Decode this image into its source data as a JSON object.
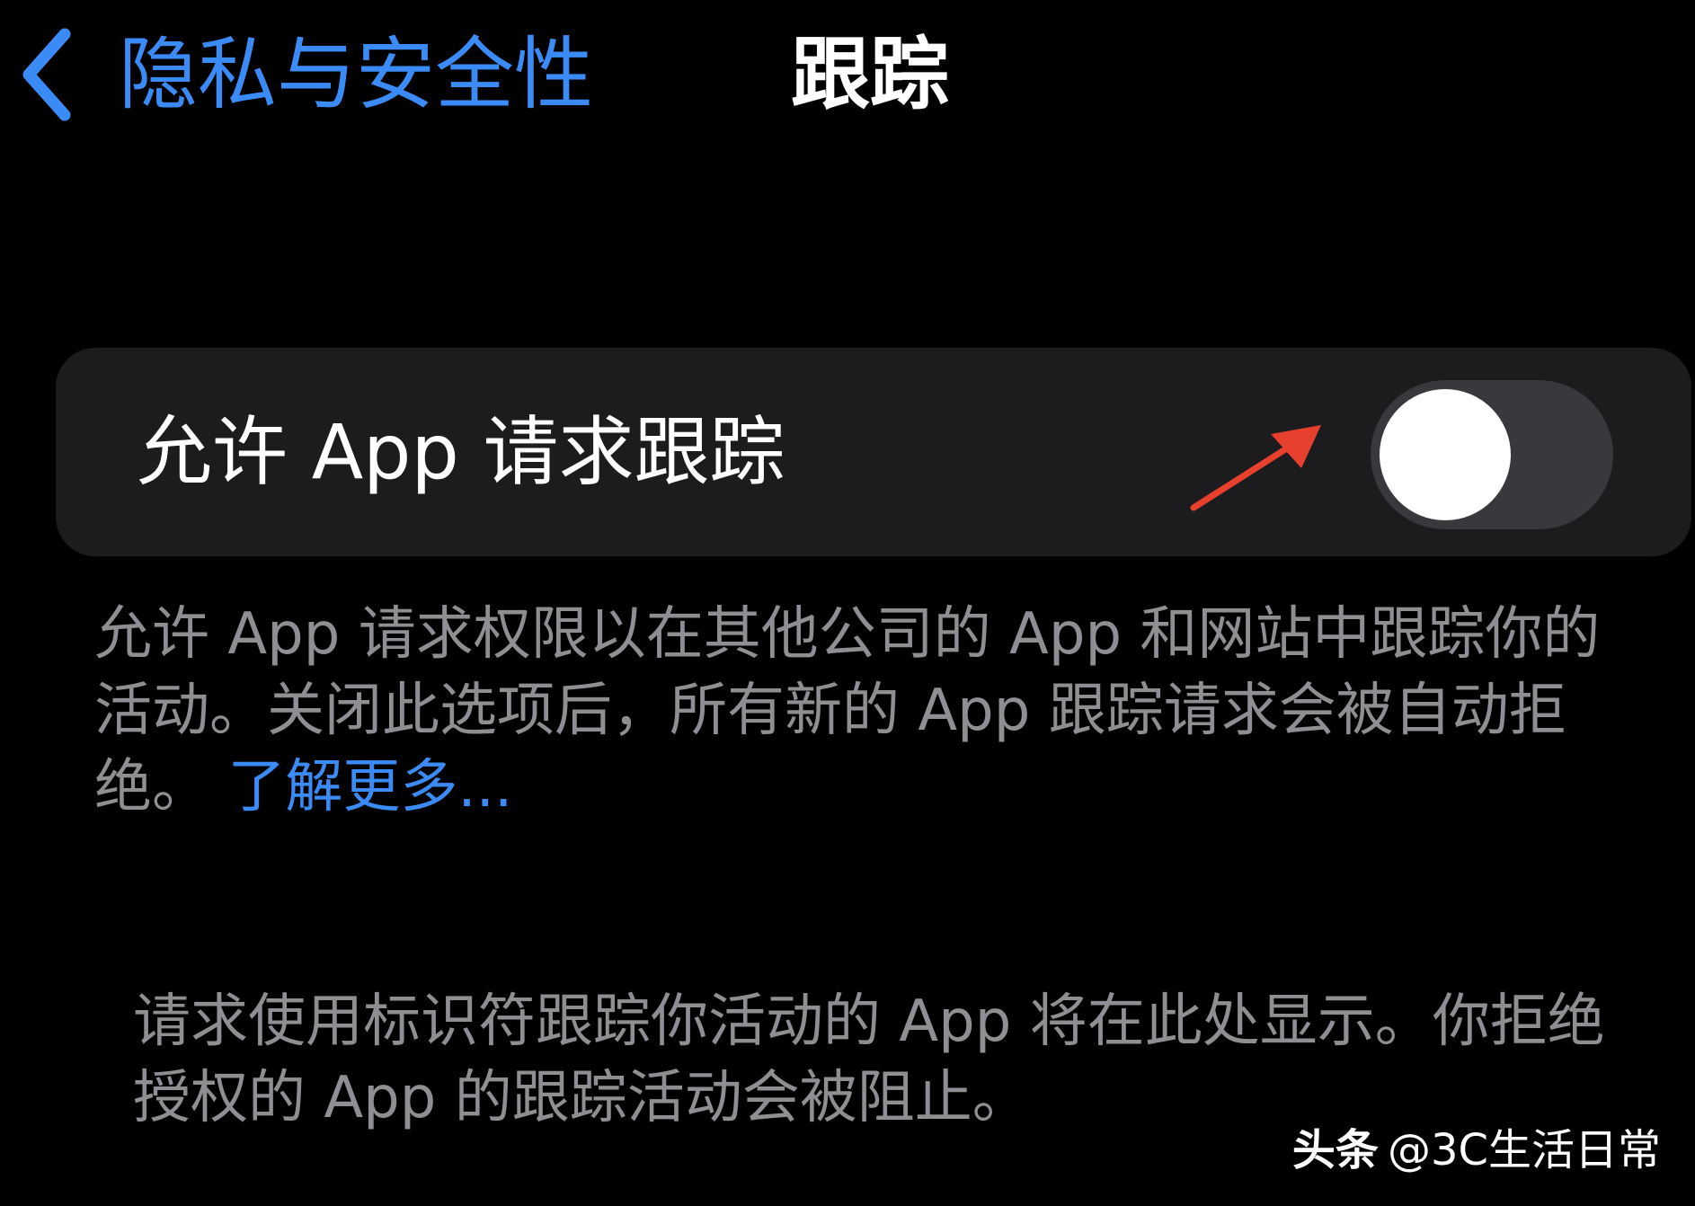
{
  "nav": {
    "back_label": "隐私与安全性",
    "title": "跟踪"
  },
  "toggle": {
    "label": "允许 App 请求跟踪",
    "state": "off"
  },
  "description": {
    "text": "允许 App 请求权限以在其他公司的 App 和网站中跟踪你的活动。关闭此选项后，所有新的 App 跟踪请求会被自动拒绝。",
    "link": "了解更多..."
  },
  "info": {
    "text": "请求使用标识符跟踪你活动的 App 将在此处显示。你拒绝授权的 App 的跟踪活动会被阻止。"
  },
  "watermark": {
    "source": "头条",
    "handle": "@3C生活日常"
  },
  "colors": {
    "background": "#000000",
    "card": "#1C1C1E",
    "accent_blue": "#3A8BF5",
    "switch_off": "#39393D",
    "secondary_text": "#8E8E93",
    "annotation_arrow": "#E8402F"
  },
  "icons": {
    "back": "chevron-left-icon",
    "annotation": "red-arrow-annotation"
  }
}
